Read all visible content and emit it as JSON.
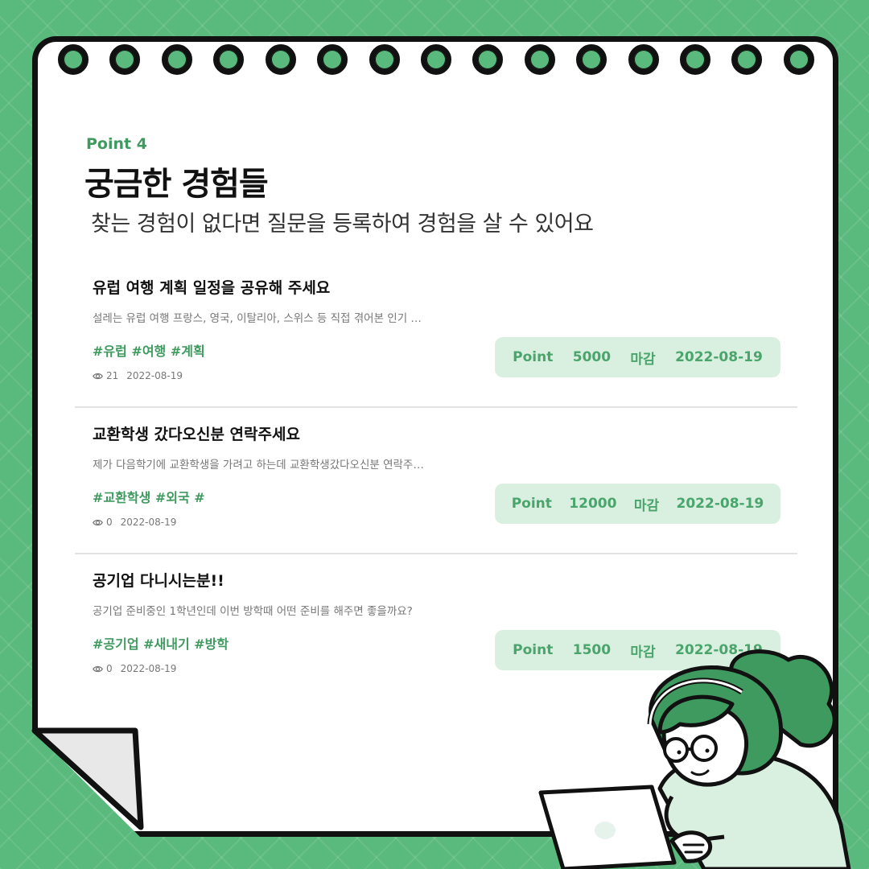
{
  "header": {
    "point_label": "Point 4",
    "title": "궁금한 경험들",
    "subtitle": "찾는 경험이 없다면 질문을 등록하여 경험을 살 수 있어요"
  },
  "questions": [
    {
      "title": "유럽 여행 계획 일정을 공유해 주세요",
      "description": "설레는 유럽 여행 프랑스, 영국, 이탈리아, 스위스 등 직접 겪어본 인기 …",
      "tags": "#유럽 #여행 #계획",
      "views": "21",
      "date": "2022-08-19",
      "point_label": "Point",
      "point_value": "5000",
      "deadline_label": "마감",
      "deadline": "2022-08-19"
    },
    {
      "title": "교환학생 갔다오신분 연락주세요",
      "description": "제가 다음학기에 교환학생을 가려고 하는데 교환학생갔다오신분 연락주…",
      "tags": "#교환학생 #외국 #",
      "views": "0",
      "date": "2022-08-19",
      "point_label": "Point",
      "point_value": "12000",
      "deadline_label": "마감",
      "deadline": "2022-08-19"
    },
    {
      "title": "공기업 다니시는분!!",
      "description": "공기업 준비중인 1학년인데 이번 방학때 어떤 준비를 해주면 좋을까요?",
      "tags": "#공기업 #새내기 #방학",
      "views": "0",
      "date": "2022-08-19",
      "point_label": "Point",
      "point_value": "1500",
      "deadline_label": "마감",
      "deadline": "2022-08-19"
    }
  ],
  "colors": {
    "background": "#5ab97c",
    "accent": "#3f9a5f",
    "point_box": "#d9efdf"
  },
  "icons": [
    "binder-ring-icon",
    "eye-icon"
  ]
}
